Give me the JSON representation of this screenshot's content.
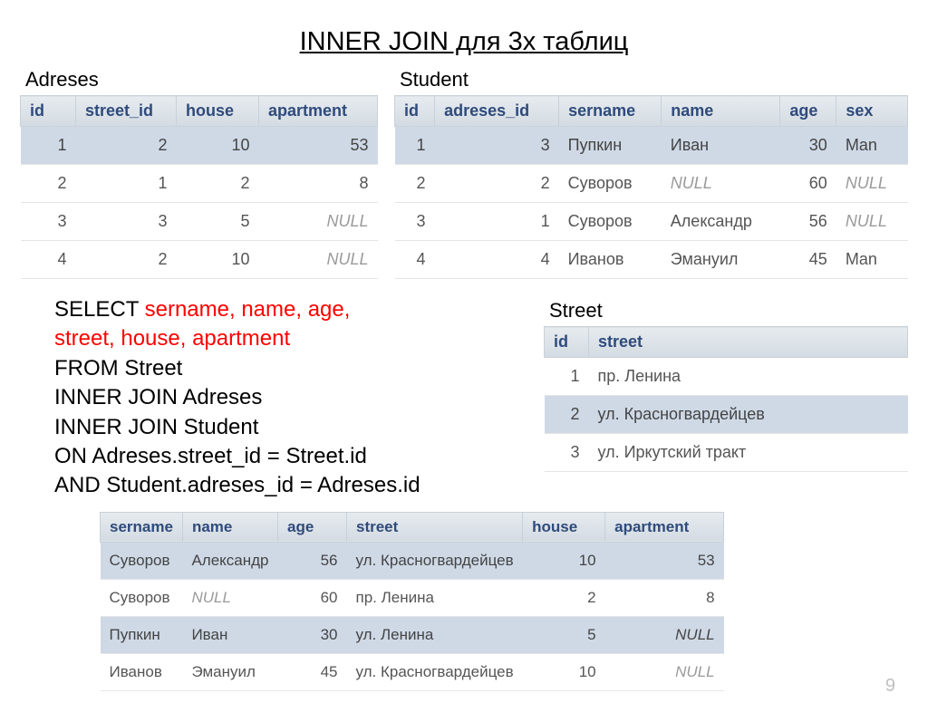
{
  "title": "INNER JOIN для 3х таблиц",
  "slide_number": "9",
  "adreses": {
    "label": "Adreses",
    "headers": [
      "id",
      "street_id",
      "house",
      "apartment"
    ],
    "rows": [
      {
        "sel": true,
        "cells": [
          "1",
          "2",
          "10",
          "53"
        ]
      },
      {
        "sel": false,
        "cells": [
          "2",
          "1",
          "2",
          "8"
        ]
      },
      {
        "sel": false,
        "cells": [
          "3",
          "3",
          "5",
          "NULL"
        ]
      },
      {
        "sel": false,
        "cells": [
          "4",
          "2",
          "10",
          "NULL"
        ]
      }
    ]
  },
  "student": {
    "label": "Student",
    "headers": [
      "id",
      "adreses_id",
      "sername",
      "name",
      "age",
      "sex"
    ],
    "rows": [
      {
        "sel": true,
        "cells": [
          "1",
          "3",
          "Пупкин",
          "Иван",
          "30",
          "Man"
        ]
      },
      {
        "sel": false,
        "cells": [
          "2",
          "2",
          "Суворов",
          "NULL",
          "60",
          "NULL"
        ]
      },
      {
        "sel": false,
        "cells": [
          "3",
          "1",
          "Суворов",
          "Александр",
          "56",
          "NULL"
        ]
      },
      {
        "sel": false,
        "cells": [
          "4",
          "4",
          "Иванов",
          "Эмануил",
          "45",
          "Man"
        ]
      }
    ]
  },
  "street": {
    "label": "Street",
    "headers": [
      "id",
      "street"
    ],
    "rows": [
      {
        "sel": false,
        "cells": [
          "1",
          "пр. Ленина"
        ]
      },
      {
        "sel": true,
        "cells": [
          "2",
          "ул. Красногвардейцев"
        ]
      },
      {
        "sel": false,
        "cells": [
          "3",
          "ул. Иркутский тракт"
        ]
      }
    ]
  },
  "sql": {
    "select_kw": "SELECT ",
    "select_cols1": "sername, name, age,",
    "select_cols2": "street, house, apartment",
    "line3": "FROM Street",
    "line4": "INNER JOIN Adreses",
    "line5": "INNER JOIN Student",
    "line6": "ON Adreses.street_id = Street.id",
    "line7": "AND Student.adreses_id = Adreses.id"
  },
  "result": {
    "headers": [
      "sername",
      "name",
      "age",
      "street",
      "house",
      "apartment"
    ],
    "rows": [
      {
        "sel": true,
        "cells": [
          "Суворов",
          "Александр",
          "56",
          "ул. Красногвардейцев",
          "10",
          "53"
        ]
      },
      {
        "sel": false,
        "cells": [
          "Суворов",
          "NULL",
          "60",
          "пр. Ленина",
          "2",
          "8"
        ]
      },
      {
        "sel": true,
        "cells": [
          "Пупкин",
          "Иван",
          "30",
          "ул. Ленина",
          "5",
          "NULL"
        ]
      },
      {
        "sel": false,
        "cells": [
          "Иванов",
          "Эмануил",
          "45",
          "ул. Красногвардейцев",
          "10",
          "NULL"
        ]
      }
    ]
  }
}
